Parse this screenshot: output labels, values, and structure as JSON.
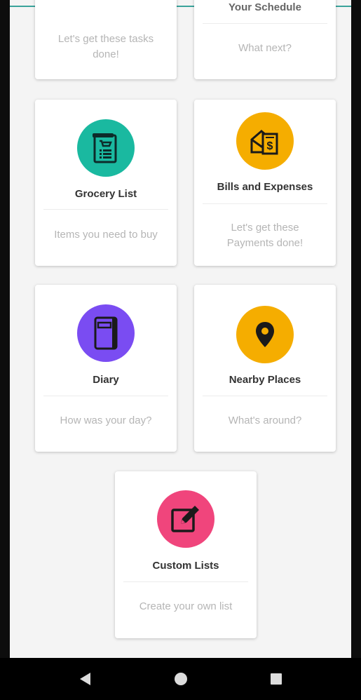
{
  "cards": {
    "todo": {
      "subtitle_line1": "Let's get these tasks",
      "subtitle_line2": "done!"
    },
    "schedule": {
      "title": "Your Schedule",
      "subtitle": "What next?"
    },
    "grocery": {
      "title": "Grocery List",
      "subtitle": "Items you need to buy",
      "icon": "grocery-list-icon",
      "color": "#1ab9a0"
    },
    "bills": {
      "title": "Bills and Expenses",
      "subtitle_line1": "Let's get these",
      "subtitle_line2": "Payments done!",
      "icon": "bills-icon",
      "color": "#f5ad00"
    },
    "diary": {
      "title": "Diary",
      "subtitle": "How was your day?",
      "icon": "diary-icon",
      "color": "#7a4cf2"
    },
    "nearby": {
      "title": "Nearby Places",
      "subtitle": "What's around?",
      "icon": "map-pin-icon",
      "color": "#f5ad00"
    },
    "custom": {
      "title": "Custom Lists",
      "subtitle": "Create your own list",
      "icon": "edit-icon",
      "color": "#f0457c"
    }
  },
  "navbar": {
    "back": "back-icon",
    "home": "home-icon",
    "recents": "recents-icon"
  }
}
